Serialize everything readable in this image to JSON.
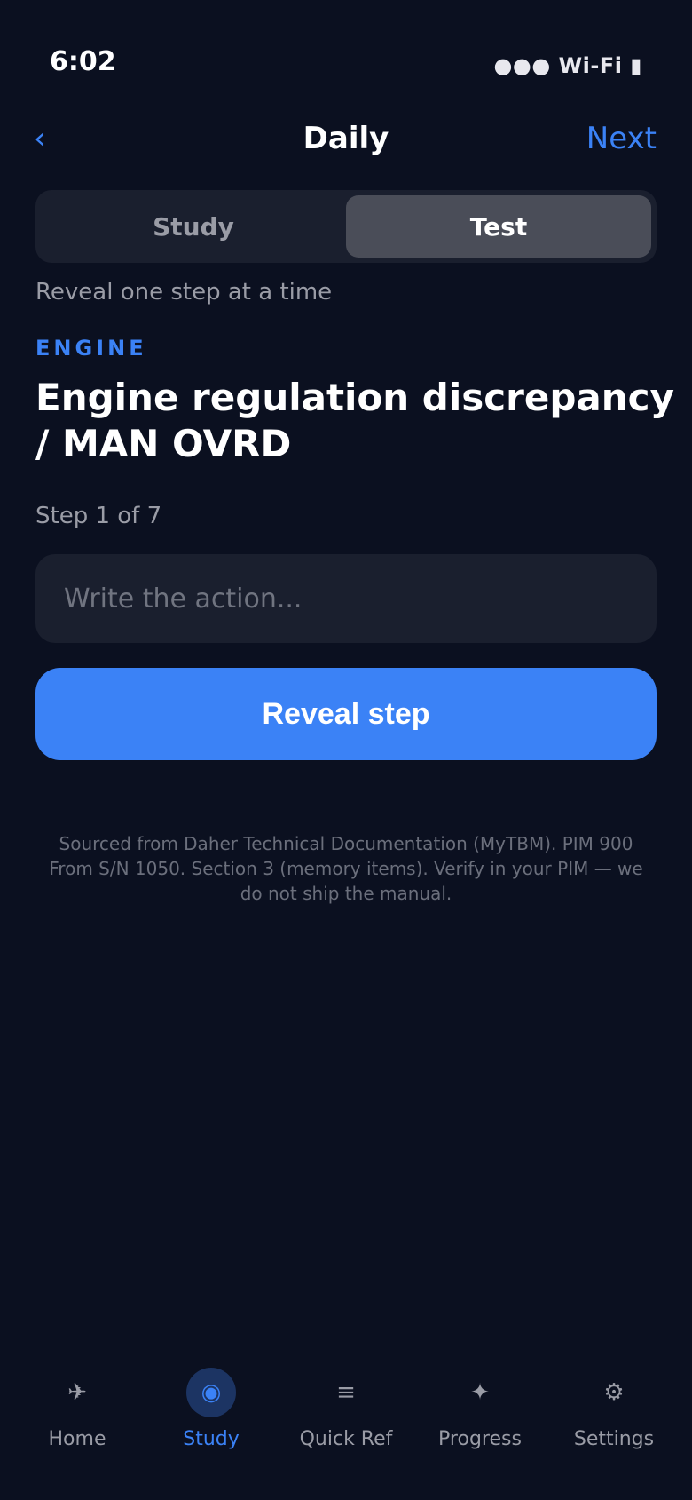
{
  "status_bar": {
    "time": "6:02",
    "indicators": "●●● Wi-Fi ▮"
  },
  "nav": {
    "back_label": "‹",
    "title": "Daily",
    "next_label": "Next"
  },
  "mode_switch": {
    "options": [
      "Study",
      "Test"
    ],
    "selected": "Test"
  },
  "hint": "Reveal one step at a time",
  "category": "ENGINE",
  "procedure_title": "Engine regulation discrepancy / MAN OVRD",
  "step_counter": "Step 1 of 7",
  "action_input": {
    "placeholder": "Write the action...",
    "value": ""
  },
  "reveal_button": "Reveal step",
  "source_note": "Sourced from Daher Technical Documentation (MyTBM). PIM 900 From S/N 1050. Section 3 (memory items). Verify in your PIM — we do not ship the manual.",
  "tabs": [
    {
      "label": "Home",
      "icon": "✈",
      "icon_name": "airplane-icon"
    },
    {
      "label": "Study",
      "icon": "◉",
      "icon_name": "target-icon"
    },
    {
      "label": "Quick Ref",
      "icon": "≡",
      "icon_name": "list-icon"
    },
    {
      "label": "Progress",
      "icon": "✦",
      "icon_name": "sparkle-icon"
    },
    {
      "label": "Settings",
      "icon": "⚙",
      "icon_name": "gear-icon"
    }
  ],
  "active_tab": "Study",
  "colors": {
    "background": "#0b1020",
    "accent": "#3b82f6",
    "surface": "#1a1f2e",
    "selected_segment": "#4a4d58",
    "muted_text": "#9a9ca6"
  }
}
